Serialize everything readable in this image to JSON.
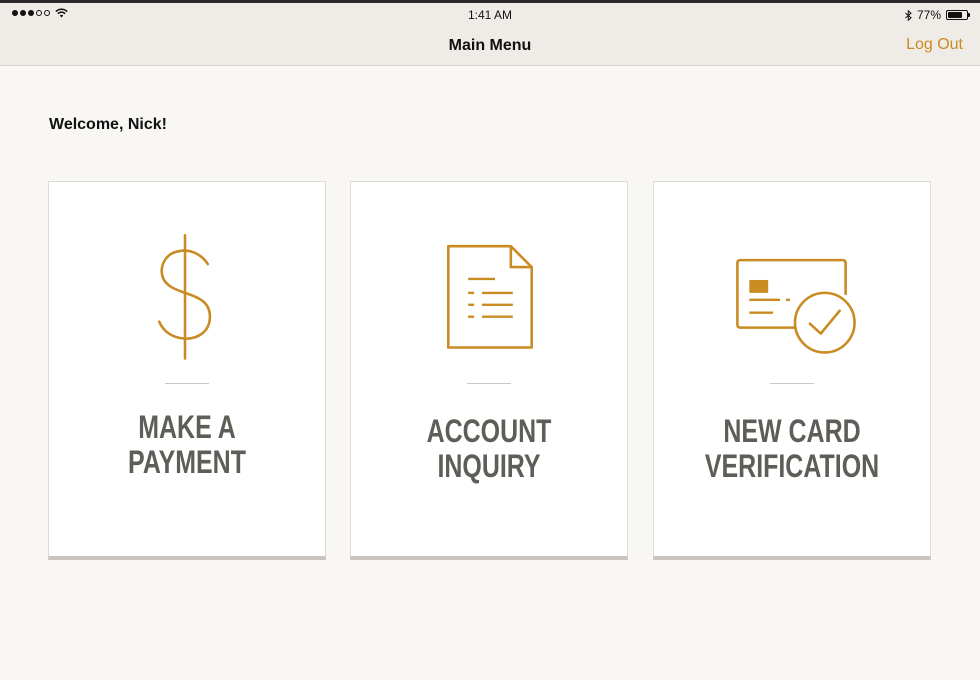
{
  "status_bar": {
    "signal_dots_filled": 3,
    "signal_dots_total": 5,
    "time": "1:41 AM",
    "battery_percent_label": "77%",
    "battery_level": 0.77
  },
  "nav": {
    "title": "Main Menu",
    "logout_label": "Log Out"
  },
  "welcome": "Welcome, Nick!",
  "accent_color": "#c98b22",
  "cards": [
    {
      "line1": "MAKE A",
      "line2": "PAYMENT",
      "icon": "dollar-icon"
    },
    {
      "line1": "ACCOUNT",
      "line2": "INQUIRY",
      "icon": "document-icon"
    },
    {
      "line1": "NEW CARD",
      "line2": "VERIFICATION",
      "icon": "card-check-icon"
    }
  ]
}
